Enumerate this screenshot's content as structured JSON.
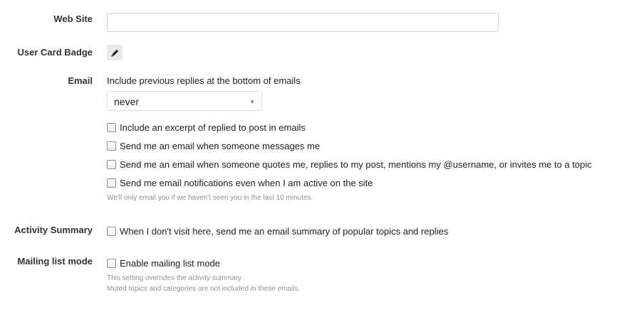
{
  "website": {
    "label": "Web Site",
    "value": "",
    "placeholder": ""
  },
  "user_card_badge": {
    "label": "User Card Badge",
    "icon": "pencil-icon"
  },
  "email": {
    "label": "Email",
    "previous_replies_description": "Include previous replies at the bottom of emails",
    "previous_replies_value": "never",
    "checkboxes": [
      {
        "label": "Include an excerpt of replied to post in emails",
        "checked": false
      },
      {
        "label": "Send me an email when someone messages me",
        "checked": false
      },
      {
        "label": "Send me an email when someone quotes me, replies to my post, mentions my @username, or invites me to a topic",
        "checked": false
      },
      {
        "label": "Send me email notifications even when I am active on the site",
        "checked": false
      }
    ],
    "hint": "We'll only email you if we haven't seen you in the last 10 minutes."
  },
  "activity_summary": {
    "label": "Activity Summary",
    "checkbox_label": "When I don't visit here, send me an email summary of popular topics and replies",
    "checked": false
  },
  "mailing_list": {
    "label": "Mailing list mode",
    "checkbox_label": "Enable mailing list mode",
    "checked": false,
    "hint_1": "This setting overrides the activity summary.",
    "hint_2": "Muted topics and categories are not included in these emails."
  }
}
